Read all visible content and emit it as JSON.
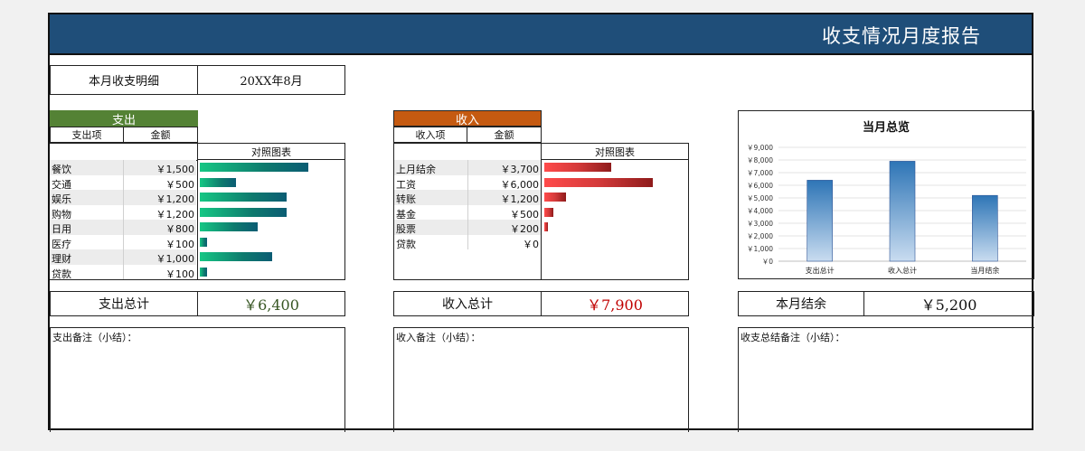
{
  "report_title": "收支情况月度报告",
  "month": {
    "label": "本月收支明细",
    "value": "20XX年8月"
  },
  "expense": {
    "header": "支出",
    "col_item": "支出项",
    "col_amount": "金额",
    "chart_header": "对照图表",
    "color": "#548235",
    "items": [
      {
        "name": "餐饮",
        "amount_text": "￥1,500",
        "value": 1500
      },
      {
        "name": "交通",
        "amount_text": "￥500",
        "value": 500
      },
      {
        "name": "娱乐",
        "amount_text": "￥1,200",
        "value": 1200
      },
      {
        "name": "购物",
        "amount_text": "￥1,200",
        "value": 1200
      },
      {
        "name": "日用",
        "amount_text": "￥800",
        "value": 800
      },
      {
        "name": "医疗",
        "amount_text": "￥100",
        "value": 100
      },
      {
        "name": "理财",
        "amount_text": "￥1,000",
        "value": 1000
      },
      {
        "name": "贷款",
        "amount_text": "￥100",
        "value": 100
      }
    ],
    "total_label": "支出总计",
    "total_value": "￥6,400",
    "total_color": "#375623",
    "note_label": "支出备注（小结）："
  },
  "income": {
    "header": "收入",
    "col_item": "收入项",
    "col_amount": "金额",
    "chart_header": "对照图表",
    "color": "#c55a11",
    "items": [
      {
        "name": "上月结余",
        "amount_text": "￥3,700",
        "value": 3700
      },
      {
        "name": "工资",
        "amount_text": "￥6,000",
        "value": 6000
      },
      {
        "name": "转账",
        "amount_text": "￥1,200",
        "value": 1200
      },
      {
        "name": "基金",
        "amount_text": "￥500",
        "value": 500
      },
      {
        "name": "股票",
        "amount_text": "￥200",
        "value": 200
      },
      {
        "name": "贷款",
        "amount_text": "￥0",
        "value": 0
      }
    ],
    "total_label": "收入总计",
    "total_value": "￥7,900",
    "total_color": "#c00000",
    "note_label": "收入备注（小结）："
  },
  "summary": {
    "balance_label": "本月结余",
    "balance_value": "￥5,200",
    "note_label": "收支总结备注（小结）："
  },
  "chart_data": {
    "type": "bar",
    "title": "当月总览",
    "categories": [
      "支出总计",
      "收入总计",
      "当月结余"
    ],
    "values": [
      6400,
      7900,
      5200
    ],
    "ylim": [
      0,
      9000
    ],
    "yticks": [
      "￥0",
      "￥1,000",
      "￥2,000",
      "￥3,000",
      "￥4,000",
      "￥5,000",
      "￥6,000",
      "￥7,000",
      "￥8,000",
      "￥9,000"
    ],
    "grid": true,
    "bar_color": "#2e75b6"
  }
}
